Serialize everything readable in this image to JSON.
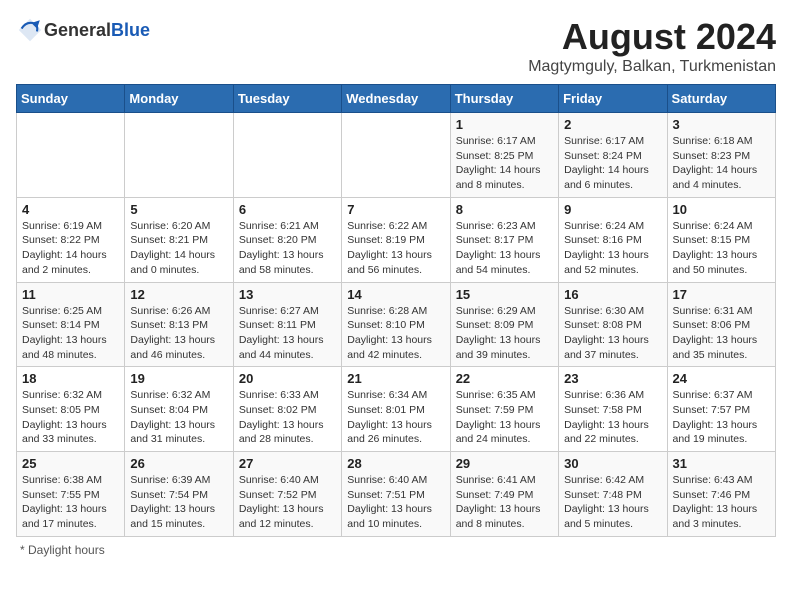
{
  "header": {
    "logo_general": "General",
    "logo_blue": "Blue",
    "title": "August 2024",
    "subtitle": "Magtymguly, Balkan, Turkmenistan"
  },
  "footer": {
    "note": "Daylight hours"
  },
  "weekdays": [
    "Sunday",
    "Monday",
    "Tuesday",
    "Wednesday",
    "Thursday",
    "Friday",
    "Saturday"
  ],
  "weeks": [
    [
      {
        "day": "",
        "info": ""
      },
      {
        "day": "",
        "info": ""
      },
      {
        "day": "",
        "info": ""
      },
      {
        "day": "",
        "info": ""
      },
      {
        "day": "1",
        "info": "Sunrise: 6:17 AM\nSunset: 8:25 PM\nDaylight: 14 hours and 8 minutes."
      },
      {
        "day": "2",
        "info": "Sunrise: 6:17 AM\nSunset: 8:24 PM\nDaylight: 14 hours and 6 minutes."
      },
      {
        "day": "3",
        "info": "Sunrise: 6:18 AM\nSunset: 8:23 PM\nDaylight: 14 hours and 4 minutes."
      }
    ],
    [
      {
        "day": "4",
        "info": "Sunrise: 6:19 AM\nSunset: 8:22 PM\nDaylight: 14 hours and 2 minutes."
      },
      {
        "day": "5",
        "info": "Sunrise: 6:20 AM\nSunset: 8:21 PM\nDaylight: 14 hours and 0 minutes."
      },
      {
        "day": "6",
        "info": "Sunrise: 6:21 AM\nSunset: 8:20 PM\nDaylight: 13 hours and 58 minutes."
      },
      {
        "day": "7",
        "info": "Sunrise: 6:22 AM\nSunset: 8:19 PM\nDaylight: 13 hours and 56 minutes."
      },
      {
        "day": "8",
        "info": "Sunrise: 6:23 AM\nSunset: 8:17 PM\nDaylight: 13 hours and 54 minutes."
      },
      {
        "day": "9",
        "info": "Sunrise: 6:24 AM\nSunset: 8:16 PM\nDaylight: 13 hours and 52 minutes."
      },
      {
        "day": "10",
        "info": "Sunrise: 6:24 AM\nSunset: 8:15 PM\nDaylight: 13 hours and 50 minutes."
      }
    ],
    [
      {
        "day": "11",
        "info": "Sunrise: 6:25 AM\nSunset: 8:14 PM\nDaylight: 13 hours and 48 minutes."
      },
      {
        "day": "12",
        "info": "Sunrise: 6:26 AM\nSunset: 8:13 PM\nDaylight: 13 hours and 46 minutes."
      },
      {
        "day": "13",
        "info": "Sunrise: 6:27 AM\nSunset: 8:11 PM\nDaylight: 13 hours and 44 minutes."
      },
      {
        "day": "14",
        "info": "Sunrise: 6:28 AM\nSunset: 8:10 PM\nDaylight: 13 hours and 42 minutes."
      },
      {
        "day": "15",
        "info": "Sunrise: 6:29 AM\nSunset: 8:09 PM\nDaylight: 13 hours and 39 minutes."
      },
      {
        "day": "16",
        "info": "Sunrise: 6:30 AM\nSunset: 8:08 PM\nDaylight: 13 hours and 37 minutes."
      },
      {
        "day": "17",
        "info": "Sunrise: 6:31 AM\nSunset: 8:06 PM\nDaylight: 13 hours and 35 minutes."
      }
    ],
    [
      {
        "day": "18",
        "info": "Sunrise: 6:32 AM\nSunset: 8:05 PM\nDaylight: 13 hours and 33 minutes."
      },
      {
        "day": "19",
        "info": "Sunrise: 6:32 AM\nSunset: 8:04 PM\nDaylight: 13 hours and 31 minutes."
      },
      {
        "day": "20",
        "info": "Sunrise: 6:33 AM\nSunset: 8:02 PM\nDaylight: 13 hours and 28 minutes."
      },
      {
        "day": "21",
        "info": "Sunrise: 6:34 AM\nSunset: 8:01 PM\nDaylight: 13 hours and 26 minutes."
      },
      {
        "day": "22",
        "info": "Sunrise: 6:35 AM\nSunset: 7:59 PM\nDaylight: 13 hours and 24 minutes."
      },
      {
        "day": "23",
        "info": "Sunrise: 6:36 AM\nSunset: 7:58 PM\nDaylight: 13 hours and 22 minutes."
      },
      {
        "day": "24",
        "info": "Sunrise: 6:37 AM\nSunset: 7:57 PM\nDaylight: 13 hours and 19 minutes."
      }
    ],
    [
      {
        "day": "25",
        "info": "Sunrise: 6:38 AM\nSunset: 7:55 PM\nDaylight: 13 hours and 17 minutes."
      },
      {
        "day": "26",
        "info": "Sunrise: 6:39 AM\nSunset: 7:54 PM\nDaylight: 13 hours and 15 minutes."
      },
      {
        "day": "27",
        "info": "Sunrise: 6:40 AM\nSunset: 7:52 PM\nDaylight: 13 hours and 12 minutes."
      },
      {
        "day": "28",
        "info": "Sunrise: 6:40 AM\nSunset: 7:51 PM\nDaylight: 13 hours and 10 minutes."
      },
      {
        "day": "29",
        "info": "Sunrise: 6:41 AM\nSunset: 7:49 PM\nDaylight: 13 hours and 8 minutes."
      },
      {
        "day": "30",
        "info": "Sunrise: 6:42 AM\nSunset: 7:48 PM\nDaylight: 13 hours and 5 minutes."
      },
      {
        "day": "31",
        "info": "Sunrise: 6:43 AM\nSunset: 7:46 PM\nDaylight: 13 hours and 3 minutes."
      }
    ]
  ]
}
